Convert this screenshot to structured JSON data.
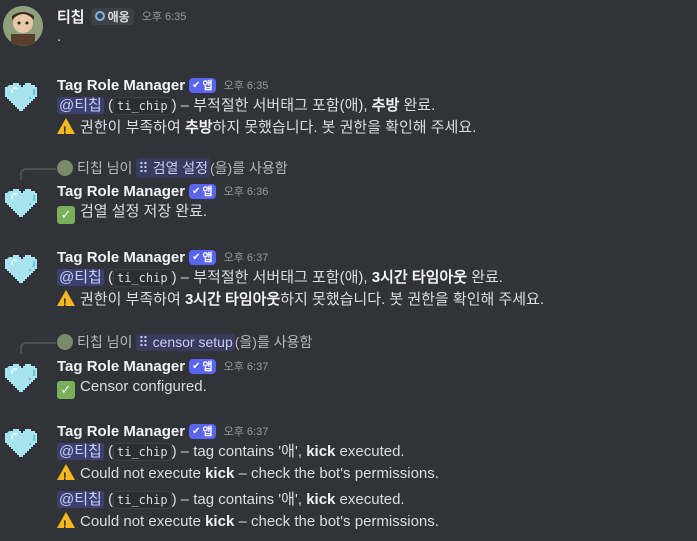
{
  "messages": [
    {
      "author": "티칩",
      "badge": "애옹",
      "time": "오후 6:35",
      "text": "."
    },
    {
      "author": "Tag Role Manager",
      "app_tag": "앱",
      "time": "오후 6:35",
      "l1_mention": "@티칩",
      "l1_code": "ti_chip",
      "l1_a": " – 부적절한 서버태그 포함(애), ",
      "l1_b": "추방",
      "l1_c": " 완료.",
      "l2_a": "권한이 부족하여 ",
      "l2_b": "추방",
      "l2_c": "하지 못했습니다. 봇 권한을 확인해 주세요."
    },
    {
      "reply_user": "티칩 님이",
      "reply_cmd": "검열 설정",
      "reply_suffix": "(을)를 사용함",
      "author": "Tag Role Manager",
      "app_tag": "앱",
      "time": "오후 6:36",
      "text": "검열 설정 저장 완료."
    },
    {
      "author": "Tag Role Manager",
      "app_tag": "앱",
      "time": "오후 6:37",
      "l1_mention": "@티칩",
      "l1_code": "ti_chip",
      "l1_a": " – 부적절한 서버태그 포함(애), ",
      "l1_b": "3시간 타임아웃",
      "l1_c": " 완료.",
      "l2_a": "권한이 부족하여 ",
      "l2_b": "3시간 타임아웃",
      "l2_c": "하지 못했습니다. 봇 권한을 확인해 주세요."
    },
    {
      "reply_user": "티칩 님이",
      "reply_cmd": "censor setup",
      "reply_suffix": "(을)를 사용함",
      "author": "Tag Role Manager",
      "app_tag": "앱",
      "time": "오후 6:37",
      "text": "Censor configured."
    },
    {
      "author": "Tag Role Manager",
      "app_tag": "앱",
      "time": "오후 6:37",
      "l1_mention": "@티칩",
      "l1_code": "ti_chip",
      "l1_a": " – tag contains '애', ",
      "l1_b": "kick",
      "l1_c": " executed.",
      "l2_a": "Could not execute ",
      "l2_b": "kick",
      "l2_c": " – check the bot's permissions.",
      "l3_mention": "@티칩",
      "l3_code": "ti_chip",
      "l3_a": " – tag contains '애', ",
      "l3_b": "kick",
      "l3_c": " executed.",
      "l4_a": "Could not execute ",
      "l4_b": "kick",
      "l4_c": " – check the bot's permissions."
    }
  ],
  "icons": {
    "bot_avatar": "pixel-heart-icon",
    "warning": "warning-icon",
    "check": "check-mark-icon"
  }
}
